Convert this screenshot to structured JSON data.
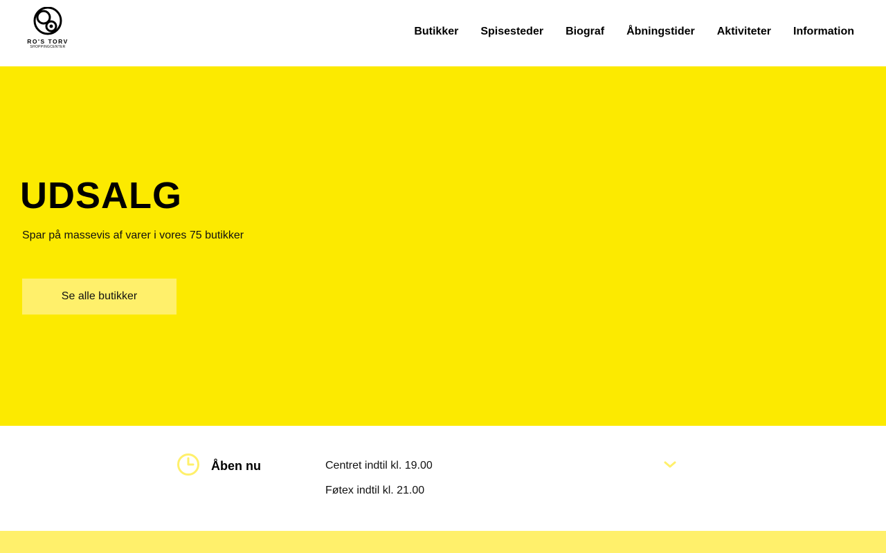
{
  "colors": {
    "brand_yellow": "#fcea00",
    "light_yellow": "#fff06b",
    "text": "#000000",
    "background": "#ffffff"
  },
  "logo": {
    "name": "RO'S TORV",
    "subtitle": "SHOPPINGCENTER",
    "icon": "ros-torv-circles-logo"
  },
  "nav": {
    "items": [
      {
        "label": "Butikker"
      },
      {
        "label": "Spisesteder"
      },
      {
        "label": "Biograf"
      },
      {
        "label": "Åbningstider"
      },
      {
        "label": "Aktiviteter"
      },
      {
        "label": "Information"
      }
    ]
  },
  "hero": {
    "title": "UDSALG",
    "subtitle": "Spar på massevis af varer i vores 75 butikker",
    "button_label": "Se alle butikker"
  },
  "hours": {
    "icon": "clock-icon",
    "label": "Åben nu",
    "lines": [
      "Centret indtil kl. 19.00",
      "Føtex indtil kl. 21.00"
    ],
    "expand_icon": "chevron-down-icon"
  }
}
